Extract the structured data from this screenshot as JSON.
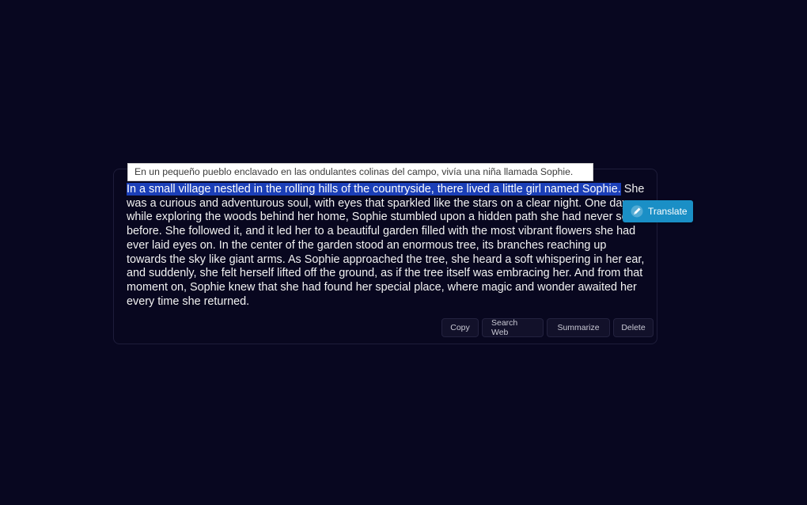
{
  "translation_tooltip": {
    "text": "En un pequeño pueblo enclavado en las ondulantes colinas del campo, vivía una niña llamada Sophie."
  },
  "passage": {
    "highlighted": "In a small village nestled in the rolling hills of the countryside, there lived a little girl named Sophie.",
    "rest": " She was a curious and adventurous soul, with eyes that sparkled like the stars on a clear night. One day, while exploring the woods behind her home, Sophie stumbled upon a hidden path she had never seen before. She followed it, and it led her to a beautiful garden filled with the most vibrant flowers she had ever laid eyes on. In the center of the garden stood an enormous tree, its branches reaching up towards the sky like giant arms. As Sophie approached the tree, she heard a soft whispering in her ear, and suddenly, she felt herself lifted off the ground, as if the tree itself was embracing her. And from that moment on, Sophie knew that she had found her special place, where magic and wonder awaited her every time she returned."
  },
  "translate_button": {
    "label": "Translate",
    "icon": "translate-icon"
  },
  "actions": {
    "copy": "Copy",
    "search_web": "Search Web",
    "summarize": "Summarize",
    "delete": "Delete"
  },
  "colors": {
    "background": "#080720",
    "highlight": "#1b3fb8",
    "translate_accent": "#1a8fc6"
  }
}
